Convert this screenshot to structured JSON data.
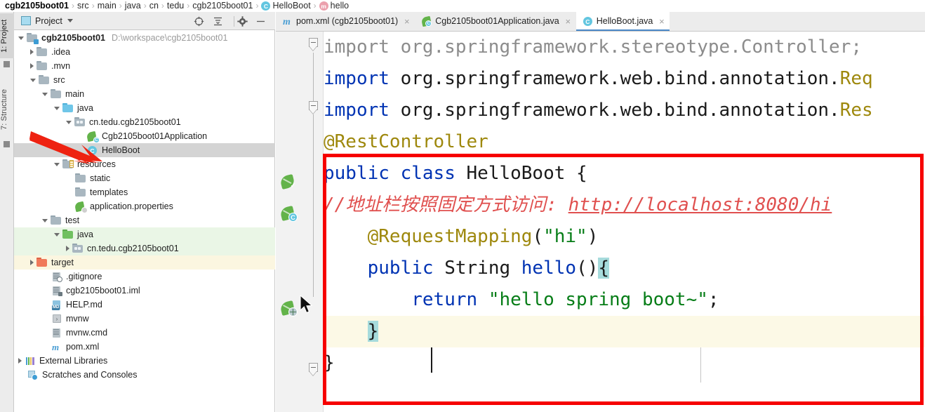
{
  "breadcrumb": {
    "items": [
      {
        "label": "cgb2105boot01",
        "icon": "none",
        "root": true
      },
      {
        "label": "src",
        "icon": "none"
      },
      {
        "label": "main",
        "icon": "none"
      },
      {
        "label": "java",
        "icon": "none"
      },
      {
        "label": "cn",
        "icon": "none"
      },
      {
        "label": "tedu",
        "icon": "none"
      },
      {
        "label": "cgb2105boot01",
        "icon": "none"
      },
      {
        "label": "HelloBoot",
        "icon": "class-icon",
        "icon_letter": "C"
      },
      {
        "label": "hello",
        "icon": "method-icon",
        "icon_letter": "m"
      }
    ],
    "separator": "›"
  },
  "left_strip": {
    "tools": [
      {
        "label": "1: Project",
        "active": true
      },
      {
        "label": "7: Structure",
        "active": false
      }
    ]
  },
  "project_panel": {
    "title": "Project",
    "header_icons": [
      {
        "name": "locate-icon",
        "glyph": "⊕"
      },
      {
        "name": "collapse-all-icon",
        "glyph": "≡"
      },
      {
        "name": "settings-gear-icon",
        "glyph": "⚙"
      },
      {
        "name": "hide-panel-icon",
        "glyph": "—"
      }
    ],
    "tree": [
      {
        "label": "cgb2105boot01",
        "path": "D:\\workspace\\cgb2105boot01",
        "indent": 0,
        "arrow": "down",
        "icon": "module-folder-icon",
        "bold": true,
        "state": "normal"
      },
      {
        "label": ".idea",
        "indent": 1,
        "arrow": "right",
        "icon": "folder-gray-icon",
        "state": "normal"
      },
      {
        "label": ".mvn",
        "indent": 1,
        "arrow": "right",
        "icon": "folder-gray-icon",
        "state": "normal"
      },
      {
        "label": "src",
        "indent": 1,
        "arrow": "down",
        "icon": "folder-gray-icon",
        "state": "normal"
      },
      {
        "label": "main",
        "indent": 2,
        "arrow": "down",
        "icon": "folder-gray-icon",
        "state": "normal"
      },
      {
        "label": "java",
        "indent": 3,
        "arrow": "down",
        "icon": "folder-source-icon",
        "state": "normal"
      },
      {
        "label": "cn.tedu.cgb2105boot01",
        "indent": 4,
        "arrow": "down",
        "icon": "package-icon",
        "state": "normal"
      },
      {
        "label": "Cgb2105boot01Application",
        "indent": 5,
        "arrow": "none",
        "icon": "spring-class-icon",
        "state": "normal"
      },
      {
        "label": "HelloBoot",
        "indent": 5,
        "arrow": "none",
        "icon": "class-icon",
        "state": "selected"
      },
      {
        "label": "resources",
        "indent": 3,
        "arrow": "down",
        "icon": "folder-resources-icon",
        "state": "normal"
      },
      {
        "label": "static",
        "indent": 4,
        "arrow": "none",
        "icon": "folder-gray-icon",
        "state": "normal"
      },
      {
        "label": "templates",
        "indent": 4,
        "arrow": "none",
        "icon": "folder-gray-icon",
        "state": "normal"
      },
      {
        "label": "application.properties",
        "indent": 4,
        "arrow": "none",
        "icon": "spring-properties-icon",
        "state": "normal"
      },
      {
        "label": "test",
        "indent": 2,
        "arrow": "down",
        "icon": "folder-gray-icon",
        "state": "normal"
      },
      {
        "label": "java",
        "indent": 3,
        "arrow": "down",
        "icon": "folder-test-icon",
        "state": "green"
      },
      {
        "label": "cn.tedu.cgb2105boot01",
        "indent": 4,
        "arrow": "right",
        "icon": "package-icon",
        "state": "green"
      },
      {
        "label": "target",
        "indent": 1,
        "arrow": "right",
        "icon": "folder-excluded-icon",
        "state": "yellow"
      },
      {
        "label": ".gitignore",
        "indent": 2,
        "arrow": "none",
        "icon": "gitignore-icon",
        "state": "normal"
      },
      {
        "label": "cgb2105boot01.iml",
        "indent": 2,
        "arrow": "none",
        "icon": "iml-icon",
        "state": "normal"
      },
      {
        "label": "HELP.md",
        "indent": 2,
        "arrow": "none",
        "icon": "markdown-icon",
        "state": "normal"
      },
      {
        "label": "mvnw",
        "indent": 2,
        "arrow": "none",
        "icon": "script-icon",
        "state": "normal"
      },
      {
        "label": "mvnw.cmd",
        "indent": 2,
        "arrow": "none",
        "icon": "cmd-icon",
        "state": "normal"
      },
      {
        "label": "pom.xml",
        "indent": 2,
        "arrow": "none",
        "icon": "maven-icon",
        "state": "normal"
      },
      {
        "label": "External Libraries",
        "indent": 0,
        "arrow": "right",
        "icon": "libraries-icon",
        "state": "normal"
      },
      {
        "label": "Scratches and Consoles",
        "indent": 0,
        "arrow": "none",
        "icon": "scratches-icon",
        "state": "normal"
      }
    ]
  },
  "editor": {
    "tabs": [
      {
        "label": "pom.xml (cgb2105boot01)",
        "icon": "maven-icon",
        "active": false,
        "close": "×"
      },
      {
        "label": "Cgb2105boot01Application.java",
        "icon": "spring-class-icon",
        "active": false,
        "close": "×"
      },
      {
        "label": "HelloBoot.java",
        "icon": "class-icon",
        "active": true,
        "close": "×"
      }
    ],
    "gutter_icons": [
      {
        "name": "spring-bean-check-icon",
        "badge": "✓"
      },
      {
        "name": "spring-bean-class-icon",
        "badge": "C"
      },
      {
        "name": "spring-request-mapping-icon",
        "badge": "globe"
      }
    ],
    "code_lines": [
      {
        "indent": 0,
        "tokens": [
          {
            "t": "import org.springframework.stereotype.Controller;",
            "c": "gray"
          }
        ]
      },
      {
        "indent": 0,
        "tokens": [
          {
            "t": "import",
            "c": "kw"
          },
          {
            "t": " org.springframework.web.bind.annotation.",
            "c": "plain"
          },
          {
            "t": "Req",
            "c": "ann"
          }
        ]
      },
      {
        "indent": 0,
        "tokens": [
          {
            "t": "import",
            "c": "kw"
          },
          {
            "t": " org.springframework.web.bind.annotation.",
            "c": "plain"
          },
          {
            "t": "Res",
            "c": "ann"
          }
        ]
      },
      {
        "indent": 0,
        "tokens": [
          {
            "t": "@RestController",
            "c": "ann"
          }
        ]
      },
      {
        "indent": 0,
        "tokens": [
          {
            "t": "public",
            "c": "kw"
          },
          {
            "t": " ",
            "c": "plain"
          },
          {
            "t": "class",
            "c": "kw"
          },
          {
            "t": " HelloBoot {",
            "c": "plain"
          }
        ]
      },
      {
        "indent": 0,
        "tokens": [
          {
            "t": "//地址栏按照固定方式访问: ",
            "c": "cmt"
          },
          {
            "t": "http://localhost:8080/hi",
            "c": "cmturl"
          }
        ]
      },
      {
        "indent": 1,
        "tokens": [
          {
            "t": "@RequestMapping",
            "c": "ann"
          },
          {
            "t": "(",
            "c": "plain"
          },
          {
            "t": "\"hi\"",
            "c": "str"
          },
          {
            "t": ")",
            "c": "plain"
          }
        ]
      },
      {
        "indent": 1,
        "tokens": [
          {
            "t": "public",
            "c": "kw"
          },
          {
            "t": " String ",
            "c": "plain"
          },
          {
            "t": "hello",
            "c": "kw"
          },
          {
            "t": "()",
            "c": "plain"
          },
          {
            "t": "{",
            "c": "brace"
          }
        ]
      },
      {
        "indent": 2,
        "tokens": [
          {
            "t": "return",
            "c": "kw"
          },
          {
            "t": " ",
            "c": "plain"
          },
          {
            "t": "\"hello spring boot~\"",
            "c": "str"
          },
          {
            "t": ";",
            "c": "plain"
          }
        ]
      },
      {
        "indent": 1,
        "current": true,
        "tokens": [
          {
            "t": "}",
            "c": "brace"
          }
        ]
      },
      {
        "indent": 0,
        "tokens": [
          {
            "t": "}",
            "c": "plain"
          }
        ]
      }
    ]
  },
  "annotations": {
    "arrow_color": "#ee2211",
    "box_color": "#f60000",
    "box_target": "HelloBoot class body"
  }
}
